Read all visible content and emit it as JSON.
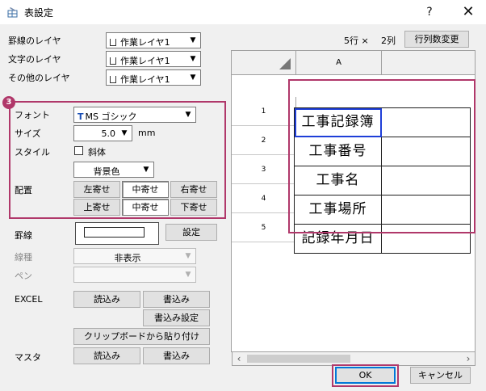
{
  "window": {
    "title": "表設定",
    "help_label": "?",
    "close_label": "✕"
  },
  "layers": {
    "ruled_label": "罫線のレイヤ",
    "text_label": "文字のレイヤ",
    "other_label": "その他のレイヤ",
    "ruled_value": "作業レイヤ1",
    "text_value": "作業レイヤ1",
    "other_value": "作業レイヤ1"
  },
  "grid_size": {
    "rows_text": "5行 ×",
    "cols_text": "2列",
    "change_button": "行列数変更"
  },
  "badge_number": "3",
  "font": {
    "label": "フォント",
    "value": "MS ゴシック",
    "type_icon_text": "T"
  },
  "size": {
    "label": "サイズ",
    "value": "5.0",
    "unit": "mm"
  },
  "style": {
    "label": "スタイル",
    "italic_label": "斜体",
    "italic_checked": false,
    "background_value": "背景色"
  },
  "alignment": {
    "label": "配置",
    "left": "左寄せ",
    "center_h": "中寄せ",
    "right": "右寄せ",
    "top": "上寄せ",
    "center_v": "中寄せ",
    "bottom": "下寄せ"
  },
  "ruled_line": {
    "label": "罫線",
    "settings_button": "設定",
    "line_type_label": "線種",
    "line_type_value": "非表示",
    "pen_label": "ペン",
    "pen_value": ""
  },
  "excel": {
    "label": "EXCEL",
    "read_button": "読込み",
    "write_button": "書込み",
    "write_settings_button": "書込み設定",
    "paste_clipboard_button": "クリップボードから貼り付け"
  },
  "master": {
    "label": "マスタ",
    "read_button": "読込み",
    "write_button": "書込み"
  },
  "grid": {
    "column_headers": [
      "A",
      ""
    ],
    "row_headers": [
      "1",
      "2",
      "3",
      "4",
      "5"
    ],
    "cells": [
      [
        "工事記録簿",
        ""
      ],
      [
        "工事番号",
        ""
      ],
      [
        "工事名",
        ""
      ],
      [
        "工事場所",
        ""
      ],
      [
        "記録年月日",
        ""
      ]
    ]
  },
  "scroll": {
    "left_arrow": "‹",
    "right_arrow": "›"
  },
  "footer": {
    "ok_button": "OK",
    "cancel_button": "キャンセル"
  },
  "colors": {
    "highlight": "#b0386a",
    "selection": "#1e3ed8",
    "focus": "#0078d7"
  }
}
